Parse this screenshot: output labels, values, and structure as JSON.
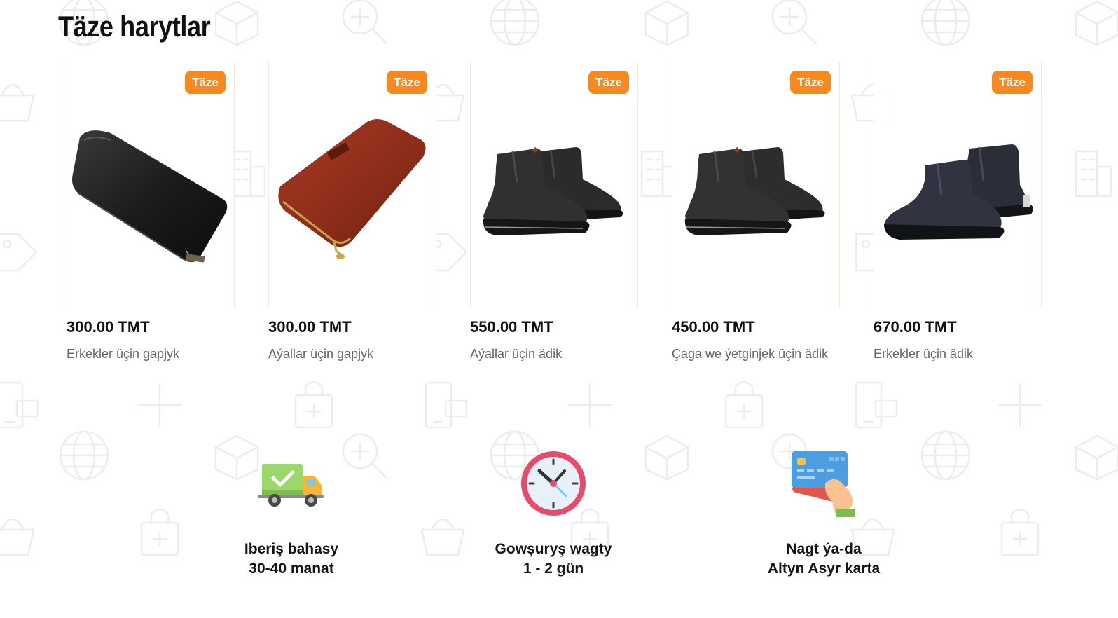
{
  "section": {
    "title": "Täze harytlar"
  },
  "products": [
    {
      "badge": "Täze",
      "price": "300.00 TMT",
      "name": "Erkekler üçin gapjyk",
      "image": "black-wallet"
    },
    {
      "badge": "Täze",
      "price": "300.00 TMT",
      "name": "Aýallar üçin gapjyk",
      "image": "red-wallet"
    },
    {
      "badge": "Täze",
      "price": "550.00 TMT",
      "name": "Aýallar üçin ädik",
      "image": "black-chelsea-boots"
    },
    {
      "badge": "Täze",
      "price": "450.00 TMT",
      "name": "Çaga we ýetginjek üçin ädik",
      "image": "black-chelsea-boots"
    },
    {
      "badge": "Täze",
      "price": "670.00 TMT",
      "name": "Erkekler üçin ädik",
      "image": "navy-chelsea-boots"
    }
  ],
  "features": [
    {
      "icon": "delivery-truck-icon",
      "line1": "Iberiş bahasy",
      "line2": "30-40 manat"
    },
    {
      "icon": "clock-icon",
      "line1": "Gowşuryş wagty",
      "line2": "1 - 2 gün"
    },
    {
      "icon": "payment-card-icon",
      "line1": "Nagt ýa-da",
      "line2": "Altyn Asyr karta"
    }
  ],
  "colors": {
    "badge": "#f7891f",
    "title": "#111111",
    "product_name": "#666666",
    "pattern": "#ececec"
  }
}
